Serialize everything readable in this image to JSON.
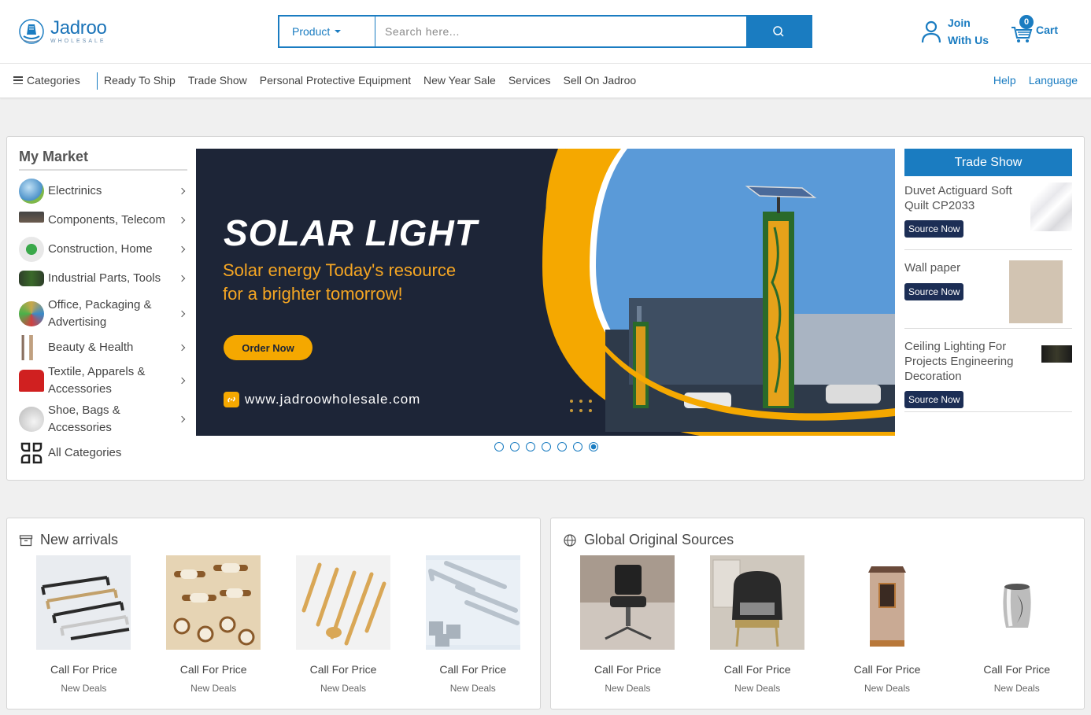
{
  "brand": {
    "name": "Jadroo",
    "tagline": "WHOLESALE",
    "accent": "#1a7cc1"
  },
  "search": {
    "category": "Product",
    "placeholder": "Search here...",
    "icon": "search-icon"
  },
  "account": {
    "join_line1": "Join",
    "join_line2": "With Us"
  },
  "cart": {
    "count": "0",
    "label": "Cart"
  },
  "nav": {
    "categories_label": "Categories",
    "links": [
      "Ready To Ship",
      "Trade Show",
      "Personal Protective Equipment",
      "New Year Sale",
      "Services",
      "Sell On Jadroo"
    ],
    "right": [
      "Help",
      "Language"
    ]
  },
  "market": {
    "title": "My Market",
    "categories": [
      {
        "label": "Electrinics",
        "color": "#4a90c8"
      },
      {
        "label": "Components, Telecom",
        "color": "#6b5b4e"
      },
      {
        "label": "Construction, Home",
        "color": "#3aa84a"
      },
      {
        "label": "Industrial Parts, Tools",
        "color": "#3a6a2a"
      },
      {
        "label": "Office, Packaging & Advertising",
        "color": "#c8a84a"
      },
      {
        "label": "Beauty & Health",
        "color": "#c0a080"
      },
      {
        "label": "Textile, Apparels & Accessories",
        "color": "#d02020"
      },
      {
        "label": "Shoe, Bags & Accessories",
        "color": "#b8b8b8"
      }
    ],
    "all_label": "All Categories"
  },
  "banner": {
    "title": "SOLAR LIGHT",
    "subtitle_line1": "Solar energy Today's resource",
    "subtitle_line2": "for a brighter tomorrow!",
    "button": "Order Now",
    "url": "www.jadroowholesale.com",
    "slides": 7,
    "active_slide": 7
  },
  "trade_show": {
    "title": "Trade Show",
    "items": [
      {
        "name": "Duvet Actiguard Soft Quilt CP2033",
        "button": "Source Now"
      },
      {
        "name": "Wall paper",
        "button": "Source Now"
      },
      {
        "name": "Ceiling Lighting For Projects Engineering Decoration",
        "button": "Source Now"
      }
    ]
  },
  "new_arrivals": {
    "title": "New arrivals",
    "products": [
      {
        "price": "Call For Price",
        "tag": "New Deals"
      },
      {
        "price": "Call For Price",
        "tag": "New Deals"
      },
      {
        "price": "Call For Price",
        "tag": "New Deals"
      },
      {
        "price": "Call For Price",
        "tag": "New Deals"
      }
    ]
  },
  "global_sources": {
    "title": "Global Original Sources",
    "products": [
      {
        "price": "Call For Price",
        "tag": "New Deals"
      },
      {
        "price": "Call For Price",
        "tag": "New Deals"
      },
      {
        "price": "Call For Price",
        "tag": "New Deals"
      },
      {
        "price": "Call For Price",
        "tag": "New Deals"
      }
    ]
  }
}
